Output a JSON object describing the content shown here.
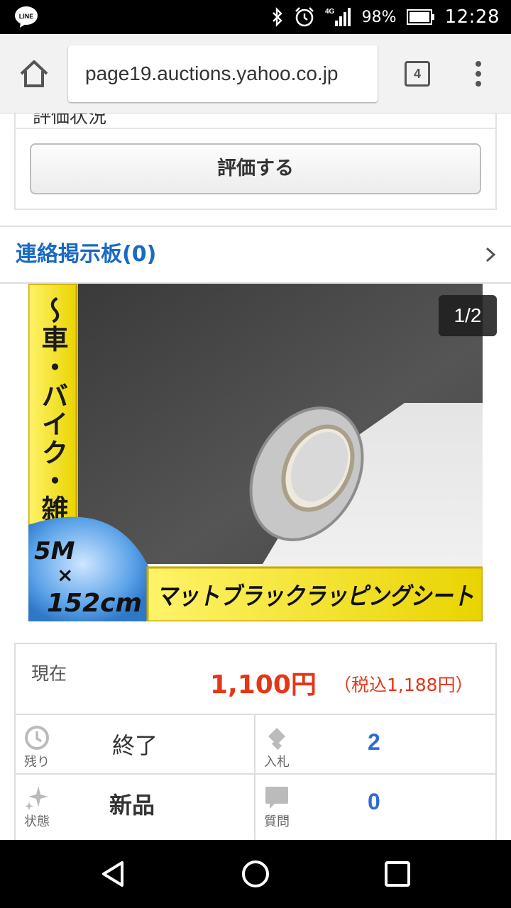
{
  "status_bar": {
    "network": "4G",
    "battery": "98%",
    "time": "12:28",
    "icons": [
      "line-app-icon",
      "bluetooth-icon",
      "alarm-icon",
      "signal-icon",
      "battery-icon"
    ]
  },
  "browser": {
    "url": "page19.auctions.yahoo.co.jp",
    "tab_count": "4"
  },
  "evaluation": {
    "cut_text": "評価状況",
    "button_label": "評価する"
  },
  "board": {
    "label": "連絡掲示板(0)"
  },
  "product_image": {
    "counter": "1/2",
    "side_banner": "〜車・バイク・雑貨〜",
    "size_badge_line1": "5M",
    "size_badge_line2": "×",
    "size_badge_line3": "152cm",
    "bottom_banner": "マットブラックラッピングシート"
  },
  "price": {
    "label": "現在",
    "value": "1,100円",
    "tax": "（税込1,188円）"
  },
  "details": {
    "remaining_label": "残り",
    "remaining_value": "終了",
    "bids_label": "入札",
    "bids_value": "2",
    "condition_label": "状態",
    "condition_value": "新品",
    "questions_label": "質問",
    "questions_value": "0"
  },
  "colors": {
    "link": "#1a6ac4",
    "price": "#e53618",
    "number": "#2f6bd1",
    "banner_yellow": "#f5e400"
  }
}
